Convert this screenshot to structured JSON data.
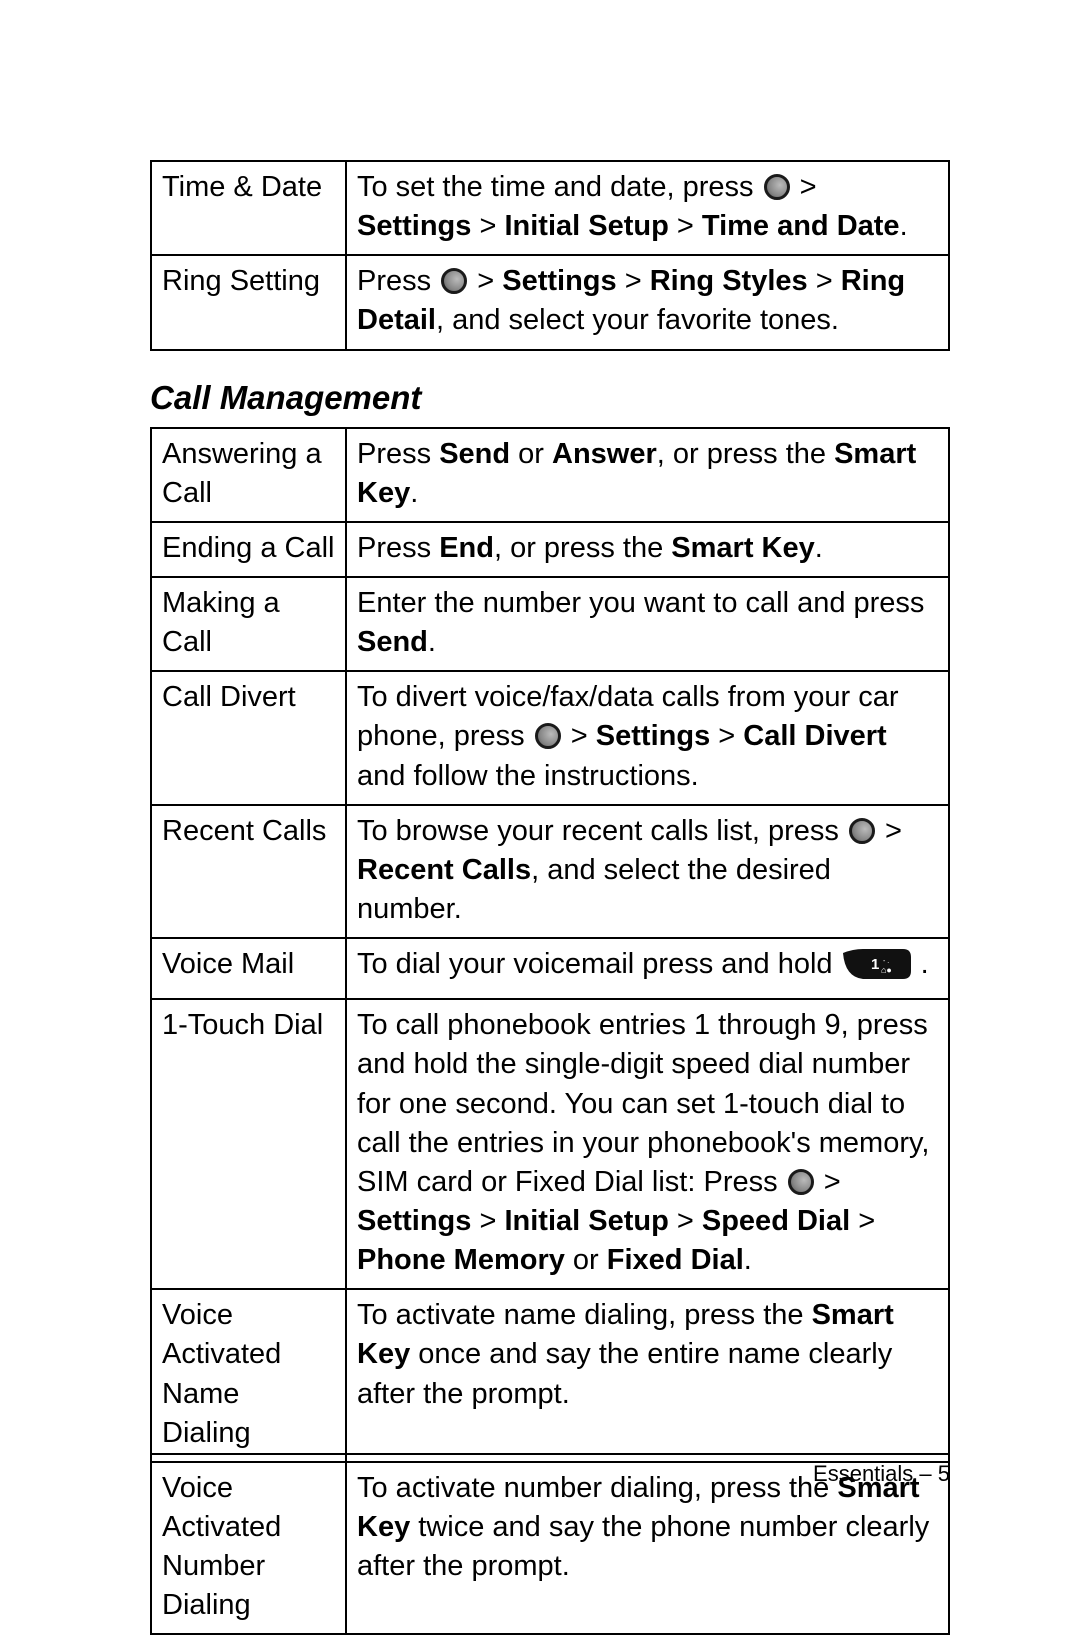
{
  "table1": {
    "rows": [
      {
        "label": "Time & Date",
        "desc": {
          "pre": "To set the time and date, press ",
          "icon": "menu",
          "path": [
            " > ",
            "Settings",
            " > ",
            "Initial Setup",
            " > ",
            "Time and Date",
            "."
          ]
        }
      },
      {
        "label": "Ring Setting",
        "desc": {
          "pre": "Press ",
          "icon": "menu",
          "path": [
            " > ",
            "Settings",
            " > ",
            "Ring Styles",
            " > ",
            "Ring Detail",
            ", and select your favorite tones."
          ]
        }
      }
    ]
  },
  "section_heading": "Call Management",
  "table2": {
    "rows": [
      {
        "label": "Answering a Call",
        "parts": [
          {
            "t": "Press "
          },
          {
            "t": "Send",
            "b": true
          },
          {
            "t": " or "
          },
          {
            "t": "Answer",
            "b": true
          },
          {
            "t": ", or press the "
          },
          {
            "t": "Smart Key",
            "b": true
          },
          {
            "t": "."
          }
        ]
      },
      {
        "label": "Ending a Call",
        "parts": [
          {
            "t": "Press "
          },
          {
            "t": "End",
            "b": true
          },
          {
            "t": ", or press the "
          },
          {
            "t": "Smart Key",
            "b": true
          },
          {
            "t": "."
          }
        ]
      },
      {
        "label": "Making a Call",
        "parts": [
          {
            "t": "Enter the number you want to call and press "
          },
          {
            "t": "Send",
            "b": true
          },
          {
            "t": "."
          }
        ]
      },
      {
        "label": "Call Divert",
        "parts": [
          {
            "t": "To divert voice/fax/data calls from your car phone, press "
          },
          {
            "icon": "menu"
          },
          {
            "t": " > "
          },
          {
            "t": "Settings",
            "b": true
          },
          {
            "t": " > "
          },
          {
            "t": "Call Divert",
            "b": true
          },
          {
            "t": " and follow the instructions."
          }
        ]
      },
      {
        "label": "Recent Calls",
        "parts": [
          {
            "t": "To browse your recent calls list, press "
          },
          {
            "icon": "menu"
          },
          {
            "t": " > "
          },
          {
            "t": "Recent Calls",
            "b": true
          },
          {
            "t": ", and select the desired number."
          }
        ]
      },
      {
        "label": "Voice Mail",
        "parts": [
          {
            "t": "To dial your voicemail press and hold "
          },
          {
            "icon": "key1"
          },
          {
            "t": " ."
          }
        ]
      },
      {
        "label": "1-Touch Dial",
        "parts": [
          {
            "t": "To call phonebook entries 1 through 9, press and hold the single-digit speed dial number for one second. You can set 1-touch dial to call the entries in your phonebook's memory, SIM card or Fixed Dial list: Press "
          },
          {
            "icon": "menu"
          },
          {
            "t": " > "
          },
          {
            "t": "Settings",
            "b": true
          },
          {
            "t": " > "
          },
          {
            "t": "Initial Setup",
            "b": true
          },
          {
            "t": " > "
          },
          {
            "t": "Speed Dial",
            "b": true
          },
          {
            "t": " > "
          },
          {
            "t": "Phone Memory",
            "b": true
          },
          {
            "t": " or "
          },
          {
            "t": "Fixed Dial",
            "b": true
          },
          {
            "t": "."
          }
        ]
      },
      {
        "label": "Voice Activated Name Dialing",
        "parts": [
          {
            "t": "To activate name dialing, press the "
          },
          {
            "t": "Smart Key",
            "b": true
          },
          {
            "t": " once and say the entire name clearly after the prompt."
          }
        ]
      },
      {
        "label": "Voice Activated Number Dialing",
        "parts": [
          {
            "t": "To activate number dialing, press the "
          },
          {
            "t": "Smart Key",
            "b": true
          },
          {
            "t": " twice and say the phone number clearly after the prompt."
          }
        ]
      }
    ]
  },
  "footer": "Essentials – 5"
}
